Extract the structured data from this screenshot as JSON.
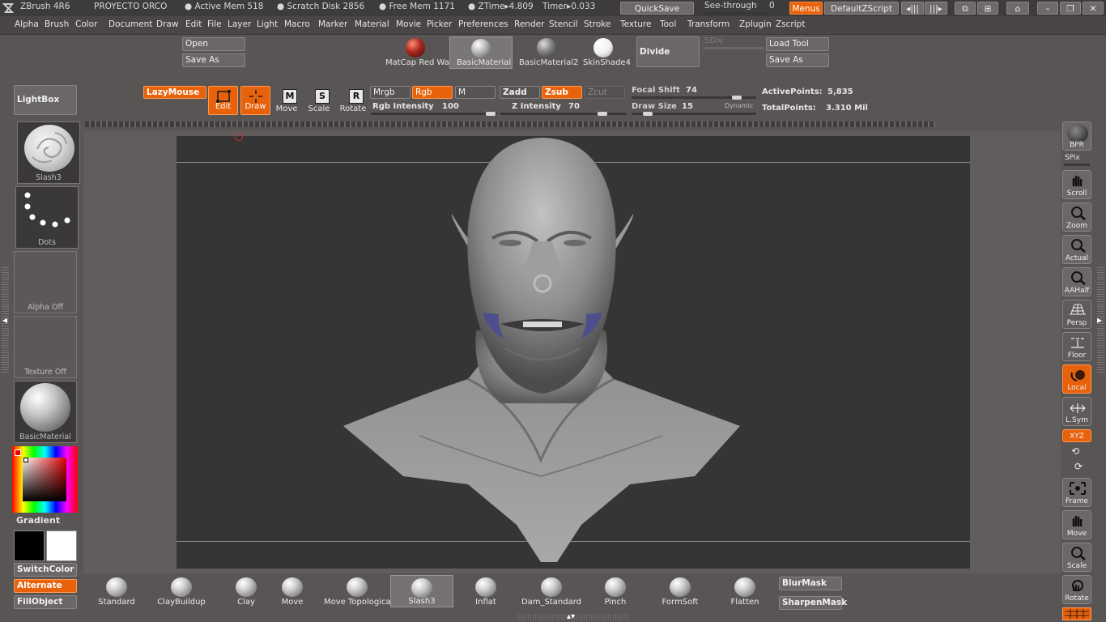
{
  "titlebar": {
    "app": "ZBrush 4R6",
    "project": "PROYECTO ORCO",
    "active_mem": "● Active Mem 518",
    "scratch_disk": "● Scratch Disk 2856",
    "free_mem": "● Free Mem 1171",
    "ztime": "● ZTime▸4.809",
    "timer": "Timer▸0.033",
    "quicksave": "QuickSave",
    "see_through_label": "See-through",
    "see_through_value": "0",
    "menus": "Menus",
    "default_zscript": "DefaultZScript"
  },
  "menubar": [
    "Alpha",
    "Brush",
    "Color",
    "Document",
    "Draw",
    "Edit",
    "File",
    "Layer",
    "Light",
    "Macro",
    "Marker",
    "Material",
    "Movie",
    "Picker",
    "Preferences",
    "Render",
    "Stencil",
    "Stroke",
    "Texture",
    "Tool",
    "Transform",
    "Zplugin",
    "Zscript"
  ],
  "toolbar1": {
    "open": "Open",
    "save_as": "Save As",
    "materials": [
      {
        "label": "MatCap Red Wa:",
        "color": "#a8281c"
      },
      {
        "label": "BasicMaterial",
        "color": "#bcbcbc"
      },
      {
        "label": "BasicMaterial2",
        "color": "#8a8a8a"
      },
      {
        "label": "SkinShade4",
        "color": "#f2f2f2"
      }
    ],
    "divide": "Divide",
    "sdiv": "SDiv",
    "load_tool": "Load Tool",
    "save_as_tool": "Save As"
  },
  "lightbox": "LightBox",
  "toolbar2": {
    "lazymouse": "LazyMouse",
    "edit": "Edit",
    "draw": "Draw",
    "move": "Move",
    "scale": "Scale",
    "rotate": "Rotate",
    "mrgb": "Mrgb",
    "rgb": "Rgb",
    "m": "M",
    "zadd": "Zadd",
    "zsub": "Zsub",
    "zcut": "Zcut",
    "rgb_intensity_label": "Rgb Intensity",
    "rgb_intensity_value": "100",
    "z_intensity_label": "Z Intensity",
    "z_intensity_value": "70",
    "focal_shift_label": "Focal Shift",
    "focal_shift_value": "74",
    "draw_size_label": "Draw Size",
    "draw_size_value": "15",
    "dynamic": "Dynamic",
    "active_points_label": "ActivePoints:",
    "active_points_value": "5,835",
    "total_points_label": "TotalPoints:",
    "total_points_value": "3.310 Mil"
  },
  "left_panel": {
    "brush_label": "Slash3",
    "stroke_label": "Dots",
    "alpha_label": "Alpha Off",
    "texture_label": "Texture Off",
    "material_label": "BasicMaterial",
    "gradient": "Gradient",
    "switch_color": "SwitchColor",
    "alternate": "Alternate",
    "fill_object": "FillObject"
  },
  "right_shelf": {
    "bpr": "BPR",
    "spix": "SPix",
    "scroll": "Scroll",
    "zoom": "Zoom",
    "actual": "Actual",
    "aahalf": "AAHalf",
    "persp": "Persp",
    "floor": "Floor",
    "local": "Local",
    "lsym": "L.Sym",
    "xyz": "XYZ",
    "frame": "Frame",
    "move": "Move",
    "scale": "Scale",
    "rotate": "Rotate"
  },
  "brush_shelf": [
    "Standard",
    "ClayBuildup",
    "Clay",
    "Move",
    "Move Topological",
    "Slash3",
    "Inflat",
    "Dam_Standard",
    "Pinch",
    "FormSoft",
    "Flatten"
  ],
  "brush_shelf_selected": "Slash3",
  "blur_mask": "BlurMask",
  "sharpen_mask": "SharpenMask",
  "colors": {
    "accent": "#e8620c",
    "canvas": "#353535",
    "primary_color": "#000000",
    "secondary_color": "#ffffff"
  }
}
